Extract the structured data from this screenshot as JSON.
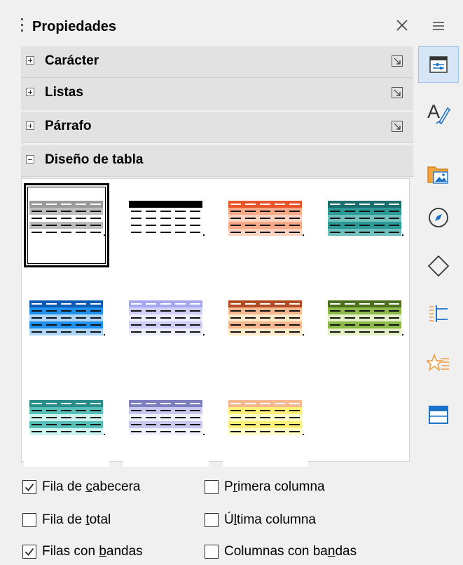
{
  "panel": {
    "title": "Propiedades",
    "close_icon": "close-icon",
    "grip_icon": "grip-icon"
  },
  "sections": {
    "caracter": {
      "label": "Carácter",
      "state": "collapsed"
    },
    "listas": {
      "label": "Listas",
      "state": "collapsed"
    },
    "parrafo": {
      "label": "Párrafo",
      "state": "collapsed"
    },
    "diseno": {
      "label": "Diseño de tabla",
      "state": "expanded"
    }
  },
  "table_styles": [
    {
      "name": "default",
      "selected": true,
      "header": "#9a9a9a",
      "band_a": "#bdbdbd",
      "band_b": "#ffffff"
    },
    {
      "name": "black",
      "selected": false,
      "header": "#000000",
      "band_a": "#ffffff",
      "band_b": "#ffffff"
    },
    {
      "name": "orange",
      "selected": false,
      "header": "#e8552a",
      "band_a": "#f7a985",
      "band_b": "#fbd3c0"
    },
    {
      "name": "teal",
      "selected": false,
      "header": "#1a6e6e",
      "band_a": "#2b9a96",
      "band_b": "#6fc0bc"
    },
    {
      "name": "blue",
      "selected": false,
      "header": "#0c5ab4",
      "band_a": "#1e90ee",
      "band_b": "#aed6fa"
    },
    {
      "name": "lavender",
      "selected": false,
      "header": "#a7a7f0",
      "band_a": "#cfcff8",
      "band_b": "#ececfd"
    },
    {
      "name": "brown",
      "selected": false,
      "header": "#b24a22",
      "band_a": "#f5b88e",
      "band_b": "#fde8c8"
    },
    {
      "name": "green",
      "selected": false,
      "header": "#4b6f1c",
      "band_a": "#8db84a",
      "band_b": "#e3f0c3"
    },
    {
      "name": "aqua",
      "selected": false,
      "header": "#2a8c88",
      "band_a": "#58c0b8",
      "band_b": "#cef4f0"
    },
    {
      "name": "slate",
      "selected": false,
      "header": "#7d7ec0",
      "band_a": "#c9c9ef",
      "band_b": "#f1f1fc"
    },
    {
      "name": "yellow",
      "selected": false,
      "header": "#f5b890",
      "band_a": "#fff07a",
      "band_b": "#ffffc8"
    }
  ],
  "options": {
    "fila_cabecera": {
      "label": "Fila de cabecera",
      "checked": true
    },
    "primera_columna": {
      "label": "Primera columna",
      "checked": false
    },
    "fila_total": {
      "label": "Fila de total",
      "checked": false
    },
    "ultima_columna": {
      "label": "Última columna",
      "checked": false
    },
    "filas_bandas": {
      "label": "Filas con bandas",
      "checked": true
    },
    "columnas_bandas": {
      "label": "Columnas con bandas",
      "checked": false
    }
  },
  "tabbar": {
    "menu_icon": "hamburger-menu-icon",
    "items": [
      {
        "icon": "properties-icon",
        "active": true
      },
      {
        "icon": "styles-icon",
        "active": false
      },
      {
        "icon": "gallery-icon",
        "active": false
      },
      {
        "icon": "navigator-icon",
        "active": false
      },
      {
        "icon": "shapes-icon",
        "active": false
      },
      {
        "icon": "page-icon",
        "active": false
      },
      {
        "icon": "style-inspector-icon",
        "active": false
      },
      {
        "icon": "manage-changes-icon",
        "active": false
      }
    ]
  }
}
